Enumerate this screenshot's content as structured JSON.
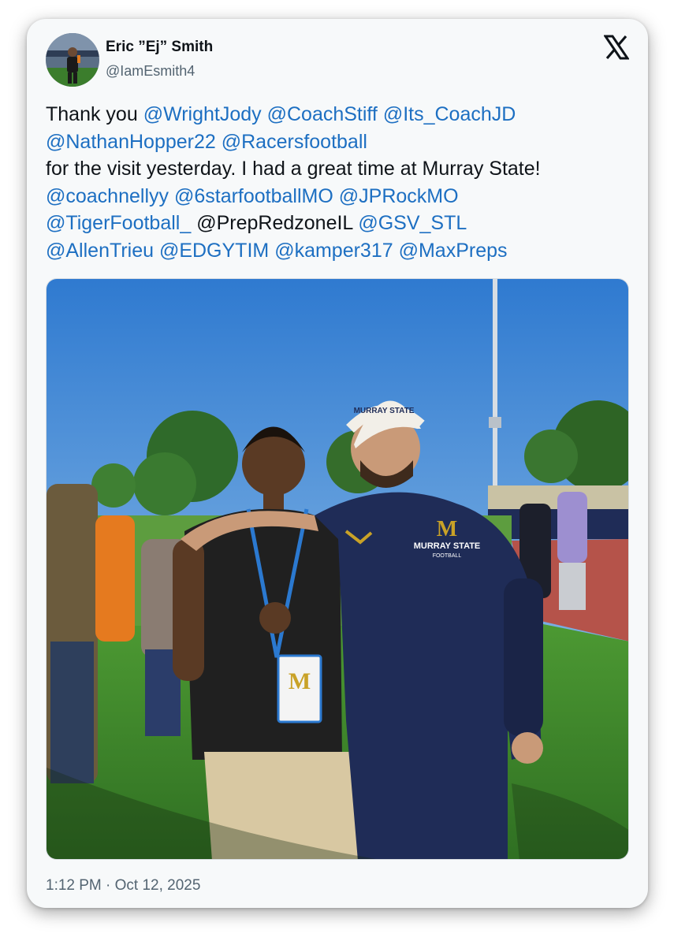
{
  "author": {
    "display_name": "Eric ”Ej” Smith",
    "handle": "@IamEsmith4"
  },
  "platform_icon": "x-logo-icon",
  "tweet": {
    "lines": [
      [
        {
          "text": "Thank you ",
          "mention": false
        },
        {
          "text": "@WrightJody",
          "mention": true
        },
        {
          "text": " ",
          "mention": false
        },
        {
          "text": "@CoachStiff",
          "mention": true
        },
        {
          "text": " ",
          "mention": false
        },
        {
          "text": "@Its_CoachJD",
          "mention": true
        }
      ],
      [
        {
          "text": "@NathanHopper22",
          "mention": true
        },
        {
          "text": " ",
          "mention": false
        },
        {
          "text": "@Racersfootball",
          "mention": true
        }
      ],
      [
        {
          "text": " for the visit yesterday. I had a great time at Murray State!",
          "mention": false
        }
      ],
      [
        {
          "text": "@coachnellyy",
          "mention": true
        },
        {
          "text": " ",
          "mention": false
        },
        {
          "text": "@6starfootballMO",
          "mention": true
        },
        {
          "text": " ",
          "mention": false
        },
        {
          "text": "@JPRockMO",
          "mention": true
        }
      ],
      [
        {
          "text": " ",
          "mention": false
        },
        {
          "text": "@TigerFootball_",
          "mention": true
        },
        {
          "text": " @PrepRedzoneIL ",
          "mention": false
        },
        {
          "text": "@GSV_STL",
          "mention": true
        }
      ],
      [
        {
          "text": "@AllenTrieu",
          "mention": true
        },
        {
          "text": " ",
          "mention": false
        },
        {
          "text": "@EDGYTIM",
          "mention": true
        },
        {
          "text": " ",
          "mention": false
        },
        {
          "text": "@kamper317",
          "mention": true
        },
        {
          "text": " ",
          "mention": false
        },
        {
          "text": "@MaxPreps",
          "mention": true
        }
      ]
    ]
  },
  "media": {
    "cap_text": "MURRAY STATE",
    "shirt_text": "MURRAY STATE",
    "shirt_subtext": "FOOTBALL",
    "logo_letter": "M"
  },
  "timestamp": "1:12 PM · Oct 12, 2025",
  "colors": {
    "mention": "#1d6fc2",
    "sky": "#4a8fd8",
    "grass": "#3f8a2a",
    "track": "#b5534a",
    "navy_jacket": "#1f2c57",
    "gold": "#c9a227"
  }
}
